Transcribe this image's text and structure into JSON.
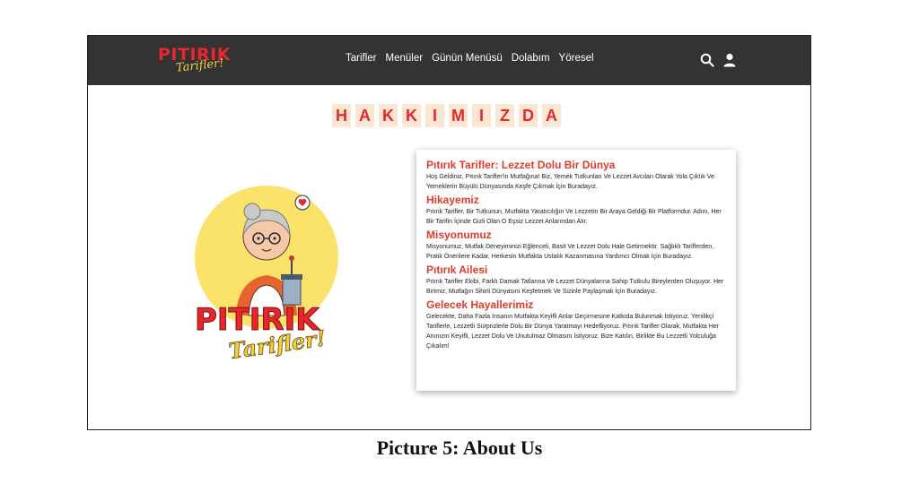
{
  "header": {
    "logo_main": "PITIRIK",
    "logo_script": "Tarifler!",
    "nav_items": [
      "Tarifler",
      "Menüler",
      "Günün Menüsü",
      "Dolabım",
      "Yöresel"
    ],
    "icons": [
      "search-icon",
      "user-icon"
    ]
  },
  "page": {
    "title_letters": [
      "H",
      "A",
      "K",
      "K",
      "I",
      "M",
      "I",
      "Z",
      "D",
      "A"
    ],
    "illustration_text_main": "PITIRIK",
    "illustration_text_script": "Tarifler!"
  },
  "card": {
    "sections": [
      {
        "heading": "Pıtırık Tarifler: Lezzet Dolu Bir Dünya",
        "body": "Hoş Geldiniz, Pıtırık Tarifler'in Mutfağına! Biz, Yemek Tutkunları Ve Lezzet Avcıları Olarak Yola Çıktık Ve Yemeklerin Büyülü Dünyasında Keşfe Çıkmak İçin Buradayız."
      },
      {
        "heading": "Hikayemiz",
        "body": "Pıtırık Tarifler, Bir Tutkunun, Mutfakta Yaratıcılığın Ve Lezzetin Bir Araya Geldiği Bir Platformdur. Adını, Her Bir Tarifin İçinde Gizli Olan O Eşsiz Lezzet Anlarından Alır."
      },
      {
        "heading": "Misyonumuz",
        "body": "Misyonumuz, Mutfak Deneyiminizi Eğlenceli, Basit Ve Lezzet Dolu Hale Getirmektir. Sağlıklı Tariflerden, Pratik Önerilere Kadar, Herkesin Mutfakta Ustalık Kazanmasına Yardımcı Olmak İçin Buradayız."
      },
      {
        "heading": "Pıtırık Ailesi",
        "body": "Pıtırık Tarifler Ekibi, Farklı Damak Tatlarına Ve Lezzet Dünyalarına Sahip Tutkulu Bireylerden Oluşuyor. Her Birimiz, Mutfağın Sihirli Dünyasını Keşfetmek Ve Sizinle Paylaşmak İçin Buradayız."
      },
      {
        "heading": "Gelecek Hayallerimiz",
        "body": "Gelecekte, Daha Fazla İnsanın Mutfakta Keyifli Anlar Geçirmesine Katkıda Bulunmak İstiyoruz. Yenilikçi Tariflerle, Lezzetli Sürprizlerle Dolu Bir Dünya Yaratmayı Hedefliyoruz. Pıtırık Tarifler Olarak, Mutfakta Her Anınızın Keyifli, Lezzet Dolu Ve Unutulmaz Olmasını İstiyoruz. Bize Katılın, Birlikte Bu Lezzetli Yolculuğa Çıkalım!"
      }
    ]
  },
  "caption": "Picture 5: About Us",
  "colors": {
    "navbar": "#333333",
    "accent_red": "#e8262b",
    "heading_red": "#e23a2a",
    "title_bg": "#fbe6d1",
    "circle_yellow": "#fbe36b"
  }
}
